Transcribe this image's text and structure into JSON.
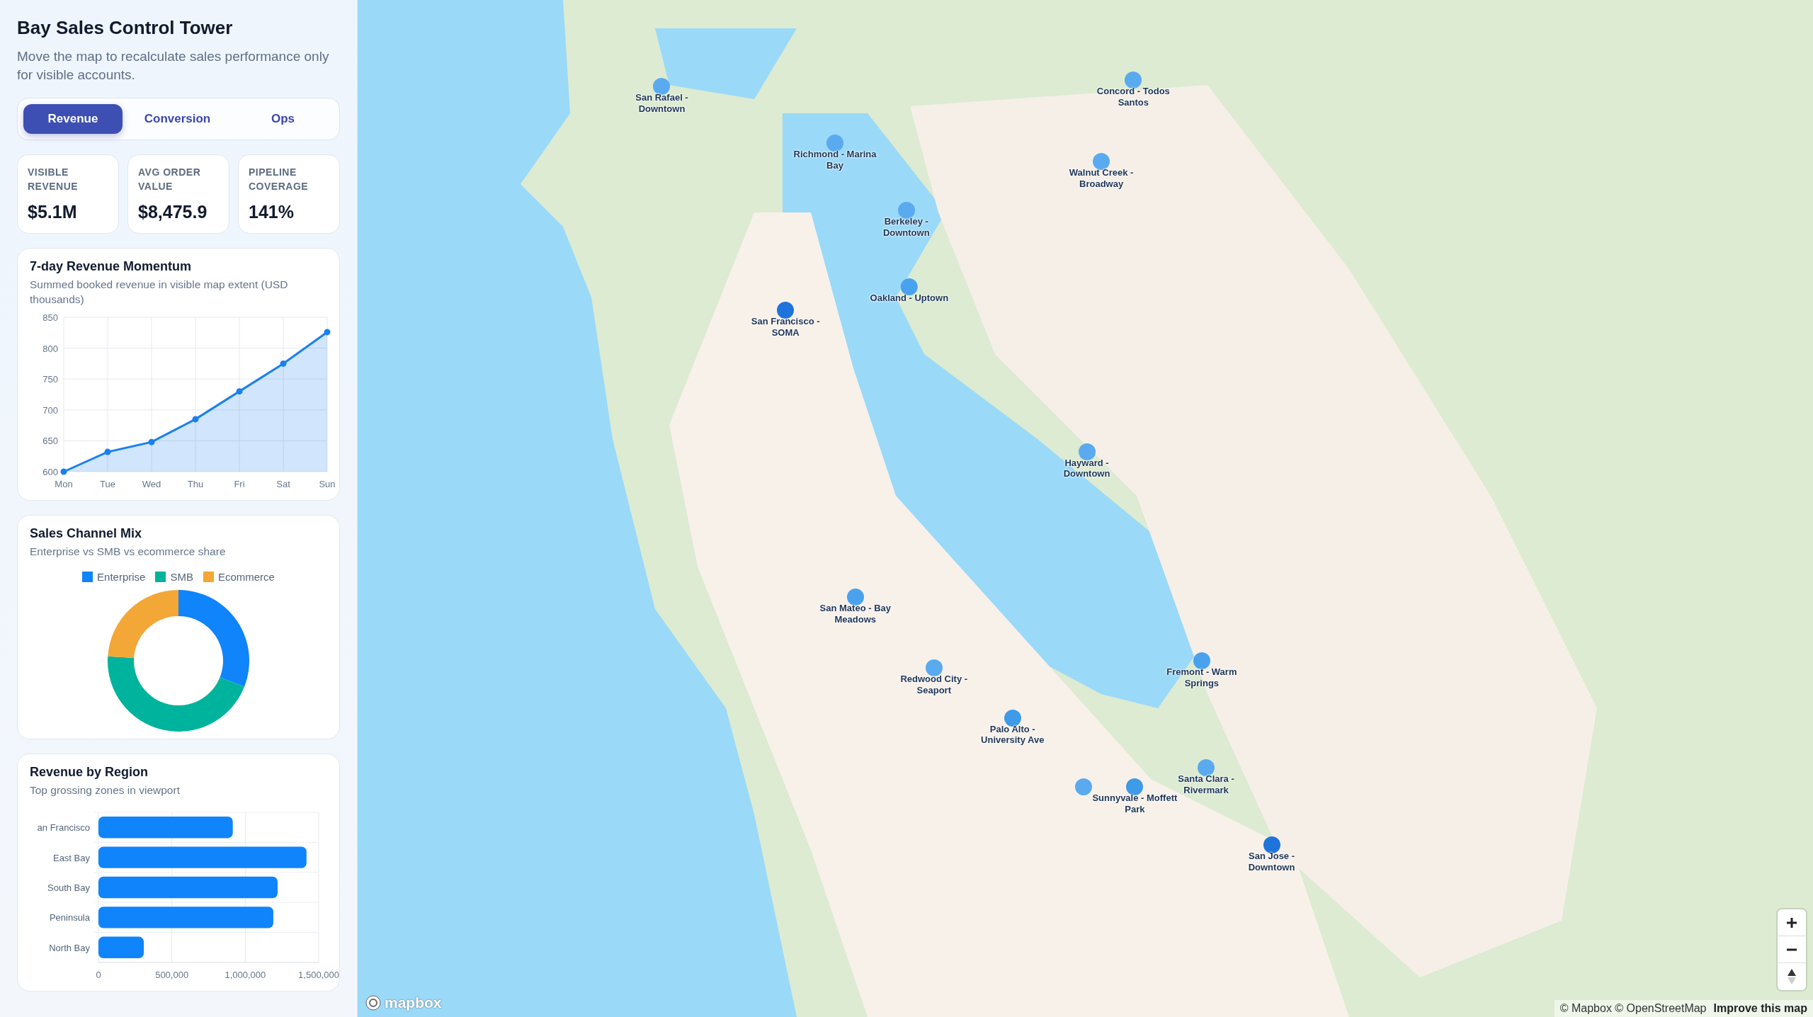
{
  "sidebar": {
    "title": "Bay Sales Control Tower",
    "subtitle": "Move the map to recalculate sales performance only for visible accounts.",
    "tabs": [
      {
        "label": "Revenue",
        "selected": true
      },
      {
        "label": "Conversion",
        "selected": false
      },
      {
        "label": "Ops",
        "selected": false
      }
    ],
    "kpis": [
      {
        "label": "VISIBLE REVENUE",
        "value": "$5.1M"
      },
      {
        "label": "AVG ORDER VALUE",
        "value": "$8,475.9"
      },
      {
        "label": "PIPELINE COVERAGE",
        "value": "141%"
      }
    ],
    "momentum_card": {
      "title": "7-day Revenue Momentum",
      "subtitle": "Summed booked revenue in visible map extent (USD thousands)",
      "chart_data": {
        "type": "area",
        "categories": [
          "Mon",
          "Tue",
          "Wed",
          "Thu",
          "Fri",
          "Sat",
          "Sun"
        ],
        "series": [
          {
            "color": "#1a7ff0",
            "values": [
              600,
              632,
              648,
              685,
              730,
              775,
              826
            ]
          }
        ],
        "grid": true,
        "ylim": [
          600,
          850
        ],
        "yticks": [
          600,
          650,
          700,
          750,
          800,
          850
        ]
      }
    },
    "channel_card": {
      "title": "Sales Channel Mix",
      "subtitle": "Enterprise vs SMB vs ecommerce share",
      "chart_data": {
        "type": "donut",
        "categories": [
          "Enterprise",
          "SMB",
          "Ecommerce"
        ],
        "series": [
          {
            "values": [
              31,
              45,
              24
            ]
          }
        ],
        "legend": true,
        "colors": [
          "#0f84fb",
          "#00b39c",
          "#f3a736"
        ]
      }
    },
    "region_card": {
      "title": "Revenue by Region",
      "subtitle": "Top grossing zones in viewport",
      "chart_data": {
        "type": "bar",
        "orientation": "horizontal",
        "categories": [
          "an Francisco",
          "East Bay",
          "South Bay",
          "Peninsula",
          "North Bay"
        ],
        "series": [
          {
            "color": "#0f84fb",
            "values": [
              915000,
              1417000,
              1220000,
              1191000,
              309000
            ]
          }
        ],
        "grid": true,
        "xlim": [
          0,
          1500000
        ],
        "xticks": [
          {
            "value": 0,
            "label": "0"
          },
          {
            "value": 500000,
            "label": "500,000"
          },
          {
            "value": 1000000,
            "label": "1,000,000"
          },
          {
            "value": 1500000,
            "label": "1,500,000"
          }
        ]
      }
    }
  },
  "map": {
    "markers": [
      {
        "label": "San Rafael - Downtown",
        "color": "#5aaaf0"
      },
      {
        "label": "Richmond - Marina Bay",
        "color": "#5aaaf0"
      },
      {
        "label": "Concord - Todos Santos",
        "color": "#5aaaf0"
      },
      {
        "label": "Walnut Creek - Broadway",
        "color": "#5aaaf0"
      },
      {
        "label": "Berkeley - Downtown",
        "color": "#5aaaf0"
      },
      {
        "label": "Oakland - Uptown",
        "color": "#4aa2ee"
      },
      {
        "label": "San Francisco - SOMA",
        "color": "#1f74dc"
      },
      {
        "label": "Hayward - Downtown",
        "color": "#5aaaf0"
      },
      {
        "label": "San Mateo - Bay Meadows",
        "color": "#4aa2ee"
      },
      {
        "label": "Redwood City - Seaport",
        "color": "#5aaaf0"
      },
      {
        "label": "Palo Alto - University Ave",
        "color": "#3f9ae8"
      },
      {
        "label": "Fremont - Warm Springs",
        "color": "#4aa2ee"
      },
      {
        "label": "Santa Clara - Rivermark",
        "color": "#5aaaf0"
      },
      {
        "label": "Sunnyvale - Moffett Park",
        "color": "#3f9ae8"
      },
      {
        "color": "#5aaaf0"
      },
      {
        "label": "San Jose - Downtown",
        "color": "#1f74dc"
      }
    ],
    "logo": "mapbox",
    "attribution": "© Mapbox © OpenStreetMap",
    "improve_link": "Improve this map"
  }
}
